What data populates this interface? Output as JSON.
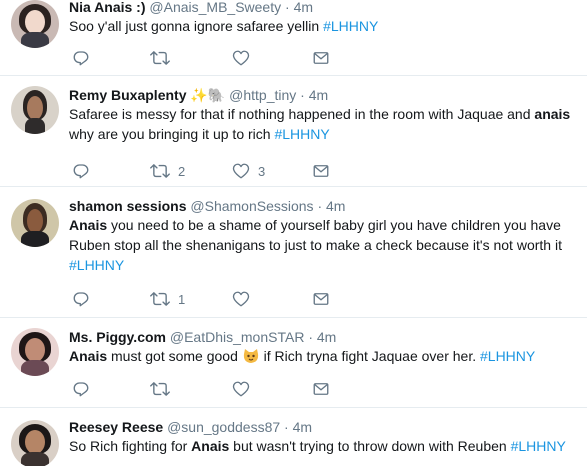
{
  "tweets": [
    {
      "name": "Nia Anais :)",
      "handle": "@Anais_MB_Sweety",
      "dot": "·",
      "time": "4m",
      "segments": [
        {
          "t": "Soo y'all just gonna ignore safaree yellin ",
          "k": "plain"
        },
        {
          "t": "#LHHNY",
          "k": "tag"
        }
      ],
      "retweets": "",
      "likes": ""
    },
    {
      "name": "Remy Buxaplenty",
      "name_emoji": "sparkles-elephant",
      "handle": "@http_tiny",
      "dot": "·",
      "time": "4m",
      "segments": [
        {
          "t": "Safaree is messy for that if nothing happened in the room with Jaquae and ",
          "k": "plain"
        },
        {
          "t": "anais",
          "k": "bold"
        },
        {
          "t": " why are you bringing it up to rich ",
          "k": "plain"
        },
        {
          "t": "#LHHNY",
          "k": "tag"
        }
      ],
      "retweets": "2",
      "likes": "3"
    },
    {
      "name": "shamon sessions",
      "handle": "@ShamonSessions",
      "dot": "·",
      "time": "4m",
      "segments": [
        {
          "t": "Anais",
          "k": "bold"
        },
        {
          "t": " you need to be a shame of yourself baby girl you have children you have Ruben stop all the shenanigans to just to make a check because it's not worth it ",
          "k": "plain"
        },
        {
          "t": "#LHHNY",
          "k": "tag"
        }
      ],
      "retweets": "1",
      "likes": ""
    },
    {
      "name": "Ms. Piggy.com",
      "handle": "@EatDhis_monSTAR",
      "dot": "·",
      "time": "4m",
      "segments": [
        {
          "t": "Anais",
          "k": "bold"
        },
        {
          "t": " must got some good ",
          "k": "plain"
        },
        {
          "t": "cat-emoji",
          "k": "emoji"
        },
        {
          "t": " if Rich tryna fight Jaquae over her. ",
          "k": "plain"
        },
        {
          "t": "#LHHNY",
          "k": "tag"
        }
      ],
      "retweets": "",
      "likes": ""
    },
    {
      "name": "Reesey Reese",
      "handle": "@sun_goddess87",
      "dot": "·",
      "time": "4m",
      "segments": [
        {
          "t": "So Rich fighting for ",
          "k": "plain"
        },
        {
          "t": "Anais",
          "k": "bold"
        },
        {
          "t": " but wasn't trying to throw down with Reuben ",
          "k": "plain"
        },
        {
          "t": "#LHHNY",
          "k": "tag"
        }
      ],
      "retweets": "",
      "likes": ""
    }
  ],
  "colors": {
    "text": "#14171a",
    "muted": "#657786",
    "hashtag": "#1b95e0",
    "divider": "#e6ecf0"
  }
}
